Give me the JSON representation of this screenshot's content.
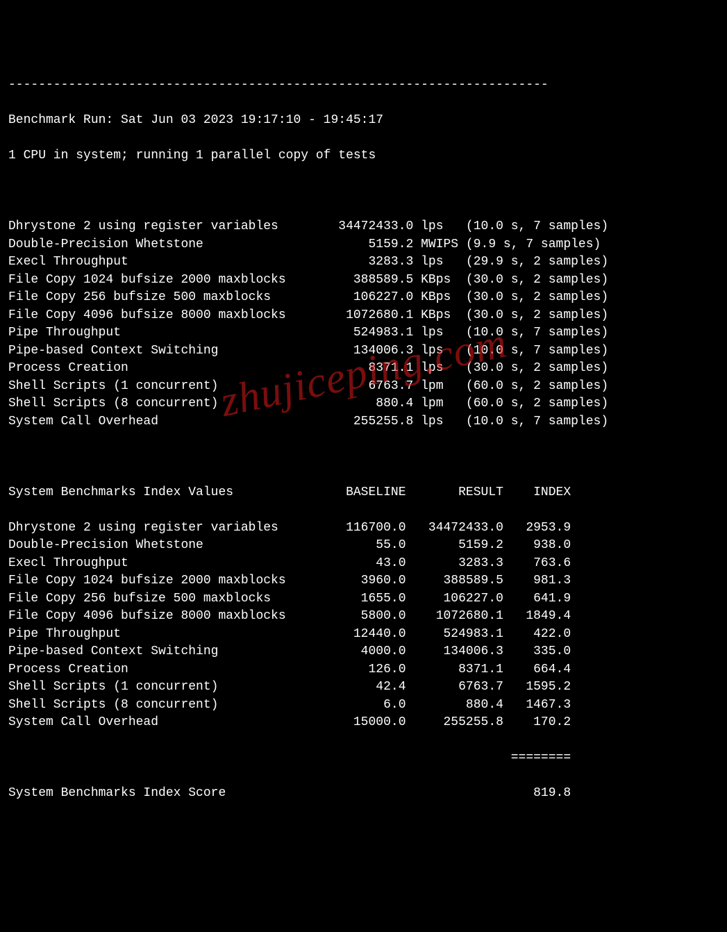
{
  "separator": "------------------------------------------------------------------------",
  "header": {
    "run_line": "Benchmark Run: Sat Jun 03 2023 19:17:10 - 19:45:17",
    "cpu_line": "1 CPU in system; running 1 parallel copy of tests"
  },
  "tests": [
    {
      "name": "Dhrystone 2 using register variables",
      "value": "34472433.0",
      "unit": "lps",
      "timing": "(10.0 s, 7 samples)"
    },
    {
      "name": "Double-Precision Whetstone",
      "value": "5159.2",
      "unit": "MWIPS",
      "timing": "(9.9 s, 7 samples)"
    },
    {
      "name": "Execl Throughput",
      "value": "3283.3",
      "unit": "lps",
      "timing": "(29.9 s, 2 samples)"
    },
    {
      "name": "File Copy 1024 bufsize 2000 maxblocks",
      "value": "388589.5",
      "unit": "KBps",
      "timing": "(30.0 s, 2 samples)"
    },
    {
      "name": "File Copy 256 bufsize 500 maxblocks",
      "value": "106227.0",
      "unit": "KBps",
      "timing": "(30.0 s, 2 samples)"
    },
    {
      "name": "File Copy 4096 bufsize 8000 maxblocks",
      "value": "1072680.1",
      "unit": "KBps",
      "timing": "(30.0 s, 2 samples)"
    },
    {
      "name": "Pipe Throughput",
      "value": "524983.1",
      "unit": "lps",
      "timing": "(10.0 s, 7 samples)"
    },
    {
      "name": "Pipe-based Context Switching",
      "value": "134006.3",
      "unit": "lps",
      "timing": "(10.0 s, 7 samples)"
    },
    {
      "name": "Process Creation",
      "value": "8371.1",
      "unit": "lps",
      "timing": "(30.0 s, 2 samples)"
    },
    {
      "name": "Shell Scripts (1 concurrent)",
      "value": "6763.7",
      "unit": "lpm",
      "timing": "(60.0 s, 2 samples)"
    },
    {
      "name": "Shell Scripts (8 concurrent)",
      "value": "880.4",
      "unit": "lpm",
      "timing": "(60.0 s, 2 samples)"
    },
    {
      "name": "System Call Overhead",
      "value": "255255.8",
      "unit": "lps",
      "timing": "(10.0 s, 7 samples)"
    }
  ],
  "index_header": {
    "title": "System Benchmarks Index Values",
    "col_baseline": "BASELINE",
    "col_result": "RESULT",
    "col_index": "INDEX"
  },
  "index_rows": [
    {
      "name": "Dhrystone 2 using register variables",
      "baseline": "116700.0",
      "result": "34472433.0",
      "index": "2953.9"
    },
    {
      "name": "Double-Precision Whetstone",
      "baseline": "55.0",
      "result": "5159.2",
      "index": "938.0"
    },
    {
      "name": "Execl Throughput",
      "baseline": "43.0",
      "result": "3283.3",
      "index": "763.6"
    },
    {
      "name": "File Copy 1024 bufsize 2000 maxblocks",
      "baseline": "3960.0",
      "result": "388589.5",
      "index": "981.3"
    },
    {
      "name": "File Copy 256 bufsize 500 maxblocks",
      "baseline": "1655.0",
      "result": "106227.0",
      "index": "641.9"
    },
    {
      "name": "File Copy 4096 bufsize 8000 maxblocks",
      "baseline": "5800.0",
      "result": "1072680.1",
      "index": "1849.4"
    },
    {
      "name": "Pipe Throughput",
      "baseline": "12440.0",
      "result": "524983.1",
      "index": "422.0"
    },
    {
      "name": "Pipe-based Context Switching",
      "baseline": "4000.0",
      "result": "134006.3",
      "index": "335.0"
    },
    {
      "name": "Process Creation",
      "baseline": "126.0",
      "result": "8371.1",
      "index": "664.4"
    },
    {
      "name": "Shell Scripts (1 concurrent)",
      "baseline": "42.4",
      "result": "6763.7",
      "index": "1595.2"
    },
    {
      "name": "Shell Scripts (8 concurrent)",
      "baseline": "6.0",
      "result": "880.4",
      "index": "1467.3"
    },
    {
      "name": "System Call Overhead",
      "baseline": "15000.0",
      "result": "255255.8",
      "index": "170.2"
    }
  ],
  "score_separator": "                                                                   ========",
  "score": {
    "label": "System Benchmarks Index Score",
    "value": "819.8"
  },
  "watermark": "zhujiceping.com"
}
